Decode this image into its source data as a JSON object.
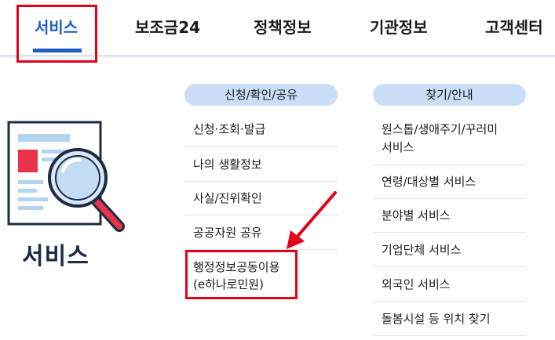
{
  "nav": {
    "tabs": [
      {
        "label": "서비스",
        "active": true
      },
      {
        "label": "보조금24"
      },
      {
        "label": "정책정보"
      },
      {
        "label": "기관정보"
      },
      {
        "label": "고객센터"
      }
    ]
  },
  "section": {
    "title": "서비스"
  },
  "groups": [
    {
      "label": "신청/확인/공유",
      "items": [
        "신청·조회·발급",
        "나의 생활정보",
        "사실/진위확인",
        "공공자원 공유",
        "행정정보공동이용",
        "(e하나로민원)"
      ]
    },
    {
      "label": "찾기/안내",
      "items": [
        "원스톱/생애주기/꾸러미",
        "서비스",
        "연령/대상별 서비스",
        "분야별 서비스",
        "기업단체 서비스",
        "외국인 서비스",
        "돌봄시설 등 위치 찾기"
      ]
    }
  ],
  "colors": {
    "accent": "#1d5fc3",
    "highlight": "#e3001b",
    "pill": "#c9dff7"
  },
  "icons": [
    "document-magnifier-icon",
    "annotation-arrow"
  ]
}
